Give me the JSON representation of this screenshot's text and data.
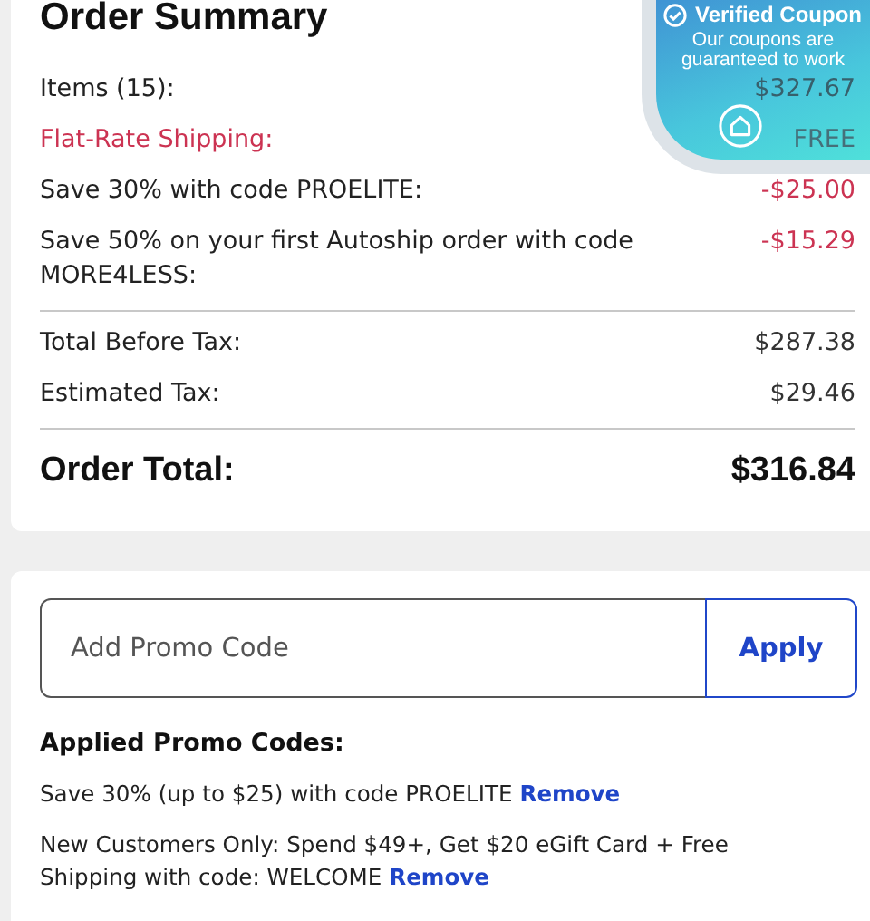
{
  "summary": {
    "title": "Order Summary",
    "lines": [
      {
        "label": "Items (15):",
        "value": "$327.67",
        "kind": "plain"
      },
      {
        "label": "Flat-Rate Shipping:",
        "value": "FREE",
        "kind": "shipping"
      },
      {
        "label": "Save 30% with code PROELITE:",
        "value": "-$25.00",
        "kind": "discount"
      },
      {
        "label": "Save 50% on your first Autoship order with code MORE4LESS:",
        "value": "-$15.29",
        "kind": "discount"
      }
    ],
    "totals": [
      {
        "label": "Total Before Tax:",
        "value": "$287.38"
      },
      {
        "label": "Estimated Tax:",
        "value": "$29.46"
      }
    ],
    "order_total": {
      "label": "Order Total:",
      "value": "$316.84"
    }
  },
  "coupon_badge": {
    "title": "Verified Coupon",
    "text": "Our coupons are guaranteed to work"
  },
  "promo": {
    "placeholder": "Add Promo Code",
    "button": "Apply",
    "applied_title": "Applied Promo Codes:",
    "applied": [
      {
        "text": "Save 30% (up to $25) with code PROELITE",
        "action": "Remove"
      },
      {
        "text": "New Customers Only: Spend $49+, Get $20 eGift Card + Free Shipping with code: WELCOME",
        "action": "Remove"
      }
    ]
  }
}
